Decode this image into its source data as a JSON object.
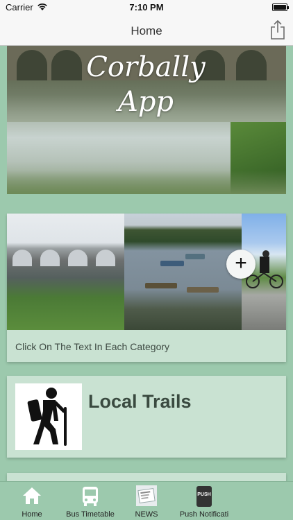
{
  "status_bar": {
    "carrier": "Carrier",
    "time": "7:10 PM"
  },
  "nav": {
    "title": "Home",
    "share_icon": "share-icon"
  },
  "hero": {
    "title_line1": "Corbally",
    "title_line2": "App"
  },
  "gallery": {
    "caption": "Click On The Text In Each Category",
    "add_icon": "plus-icon"
  },
  "categories": [
    {
      "label": "Local Trails",
      "icon": "hiker-icon"
    }
  ],
  "tabs": [
    {
      "label": "Home",
      "icon": "home-icon"
    },
    {
      "label": "Bus Timetable",
      "icon": "bus-icon"
    },
    {
      "label": "NEWS",
      "icon": "news-icon"
    },
    {
      "label": "Push Notificati",
      "icon": "push-icon",
      "icon_text": "PUSH"
    }
  ],
  "colors": {
    "background": "#9cc9ad",
    "card": "#c9e2d2",
    "bar": "#f7f7f7"
  }
}
